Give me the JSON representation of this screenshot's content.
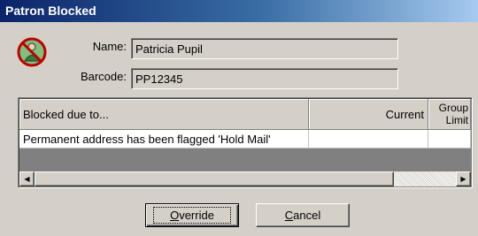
{
  "window": {
    "title": "Patron Blocked"
  },
  "form": {
    "name_label": "Name:",
    "name_value": "Patricia Pupil",
    "barcode_label": "Barcode:",
    "barcode_value": "PP12345"
  },
  "grid": {
    "columns": [
      "Blocked due to...",
      "Current",
      "Group",
      "Limit"
    ],
    "rows": [
      {
        "reason": "Permanent address has been flagged 'Hold Mail'",
        "current": "",
        "limit": ""
      }
    ]
  },
  "buttons": {
    "override_mnemonic": "O",
    "override_rest": "verride",
    "cancel_mnemonic": "C",
    "cancel_rest": "ancel"
  },
  "icons": {
    "patron": "blocked-patron-icon"
  },
  "colors": {
    "title_start": "#0a246a",
    "title_end": "#a6caf0",
    "dialog_bg": "#d4d0c8"
  }
}
